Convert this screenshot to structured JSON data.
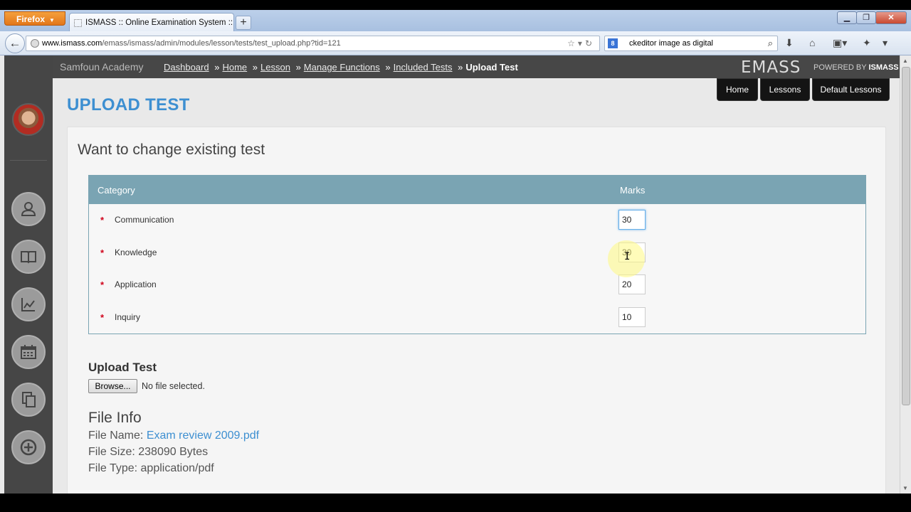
{
  "browser": {
    "app_button": "Firefox",
    "tab_title": "ISMASS :: Online Examination System :: ...",
    "new_tab": "+",
    "url_domain": "www.ismass.com",
    "url_path": "/emass/ismass/admin/modules/lesson/tests/test_upload.php?tid=121",
    "search_value": "ckeditor image as digital"
  },
  "header": {
    "academy": "Samfoun Academy",
    "breadcrumb": [
      "Dashboard",
      "Home",
      "Lesson",
      "Manage Functions",
      "Included Tests"
    ],
    "breadcrumb_sep": "»",
    "breadcrumb_current": "Upload Test",
    "brand": "EMASS",
    "powered_prefix": "POWERED BY",
    "powered_brand": "ISMASS"
  },
  "topnav": [
    "Home",
    "Lessons",
    "Default Lessons"
  ],
  "page": {
    "title": "UPLOAD TEST",
    "heading": "Want to change existing test"
  },
  "table": {
    "headers": [
      "Category",
      "Marks"
    ],
    "required_mark": "*",
    "rows": [
      {
        "category": "Communication",
        "marks": "30"
      },
      {
        "category": "Knowledge",
        "marks": "30"
      },
      {
        "category": "Application",
        "marks": "20"
      },
      {
        "category": "Inquiry",
        "marks": "10"
      }
    ]
  },
  "upload": {
    "title": "Upload Test",
    "browse_label": "Browse...",
    "no_file": "No file selected."
  },
  "file_info": {
    "title": "File Info",
    "name_label": "File Name:",
    "name_value": "Exam review 2009.pdf",
    "size_label": "File Size:",
    "size_value": "238090 Bytes",
    "type_label": "File Type:",
    "type_value": "application/pdf"
  },
  "colors": {
    "accent": "#3d8fd1",
    "table_header": "#7aa4b3",
    "sidebar": "#464646",
    "required": "#d0021b"
  }
}
